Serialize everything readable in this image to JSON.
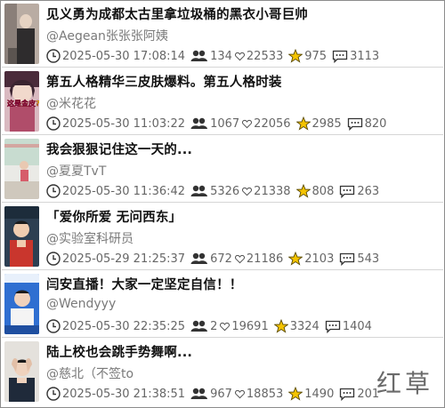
{
  "videos": [
    {
      "title": "见义勇为成都太古里拿垃圾桶的黑衣小哥巨帅",
      "author": "@Aegean张张张阿姨",
      "time": "2025-05-30 17:08:14",
      "viewers": "134",
      "likes": "22533",
      "favorites": "975",
      "comments": "3113"
    },
    {
      "title": "第五人格精华三皮肤爆料。第五人格时装",
      "author": "@米花花",
      "time": "2025-05-30 11:03:22",
      "viewers": "1067",
      "likes": "22056",
      "favorites": "2985",
      "comments": "820",
      "thumb_text": "这是金皮?"
    },
    {
      "title": "我会狠狠记住这一天的...",
      "author": "@夏夏TvT",
      "time": "2025-05-30 11:36:42",
      "viewers": "5326",
      "likes": "21338",
      "favorites": "808",
      "comments": "263"
    },
    {
      "title": "「爱你所爱 无问西东」",
      "author": "@实验室科研员",
      "time": "2025-05-29 21:25:37",
      "viewers": "672",
      "likes": "21186",
      "favorites": "2103",
      "comments": "543"
    },
    {
      "title": "闫安直播！大家一定坚定自信！！",
      "author": "@Wendyyy",
      "time": "2025-05-30 22:35:25",
      "viewers": "2",
      "likes": "19691",
      "favorites": "3324",
      "comments": "1404"
    },
    {
      "title": "陆上校也会跳手势舞啊...",
      "author": "@慈北（不签to",
      "time": "2025-05-30 21:38:51",
      "viewers": "967",
      "likes": "18853",
      "favorites": "1490",
      "comments": "201"
    }
  ],
  "watermark": "红草",
  "icons": {
    "time": "clock-icon",
    "viewers": "people-icon",
    "likes": "heart-icon",
    "favorites": "star-icon",
    "comments": "comment-icon"
  },
  "colors": {
    "star": "#f5c400",
    "text": "#111111",
    "muted": "#7a7a7a"
  }
}
